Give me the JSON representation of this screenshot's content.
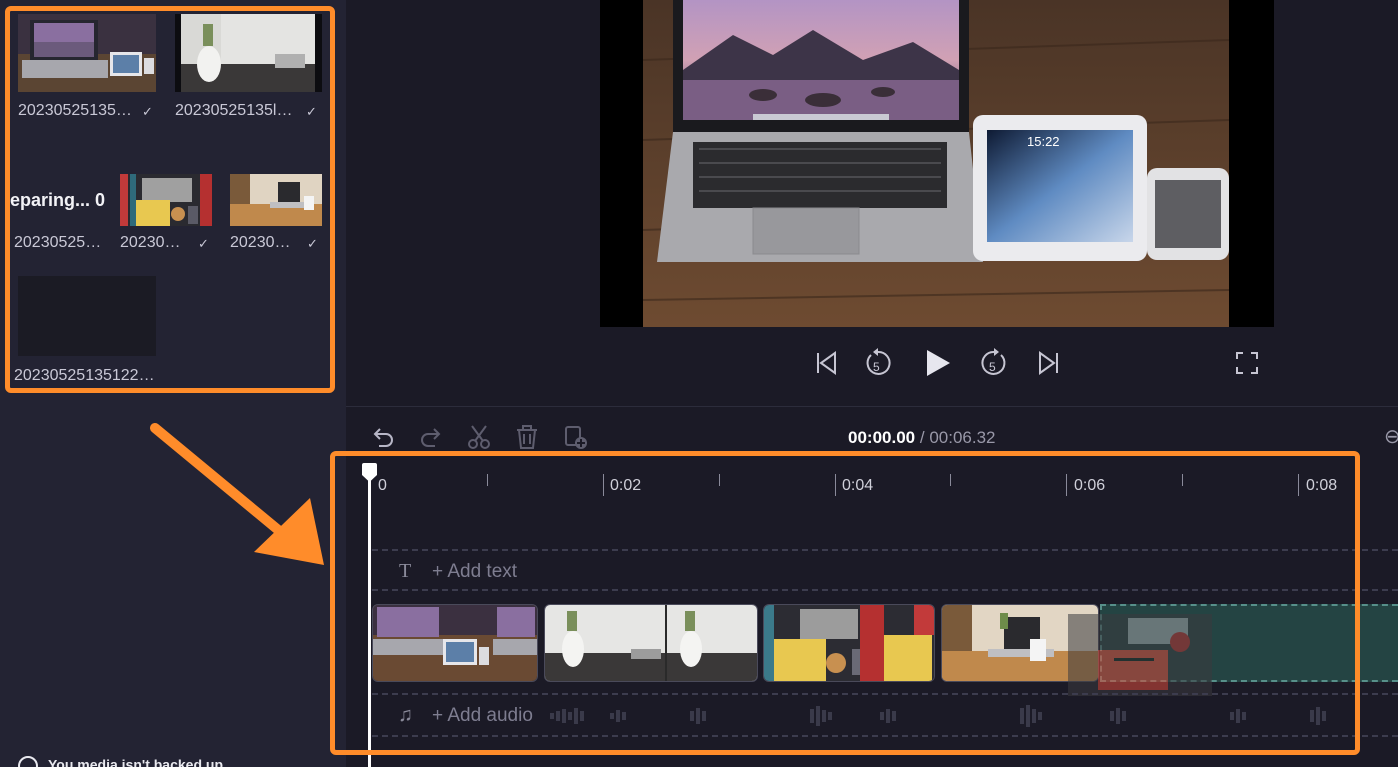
{
  "media_panel": {
    "items": [
      {
        "caption": "20230525135…",
        "checked": true
      },
      {
        "caption": "20230525135l…",
        "checked": true
      },
      {
        "caption": "20230525…",
        "checked": false,
        "preparing_label": "eparing... 0"
      },
      {
        "caption": "20230…",
        "checked": true
      },
      {
        "caption": "20230…",
        "checked": true
      },
      {
        "caption": "20230525135122…",
        "checked": false
      }
    ],
    "check_glyph": "✓",
    "bottom_note": "You media isn't backed up"
  },
  "player": {
    "icons": [
      "skip-to-start-icon",
      "rewind-5-icon",
      "play-icon",
      "forward-5-icon",
      "skip-to-end-icon",
      "fullscreen-icon"
    ],
    "rewind_label": "5",
    "forward_label": "5"
  },
  "timeline": {
    "current_time": "00:00.00",
    "separator": "/",
    "total_time": "00:06.32",
    "ruler_labels": [
      "0",
      "0:02",
      "0:04",
      "0:06",
      "0:08"
    ],
    "text_track_label": "+ Add text",
    "audio_track_label": "+ Add audio",
    "toolbar_icons": [
      "undo-icon",
      "redo-icon",
      "cut-icon",
      "delete-icon",
      "add-media-icon"
    ],
    "zoom_glyph": "⊖"
  },
  "colors": {
    "highlight": "#ff8c2a",
    "panel_bg": "#232333",
    "app_bg": "#1b1a26",
    "drop_zone": "#244443"
  }
}
